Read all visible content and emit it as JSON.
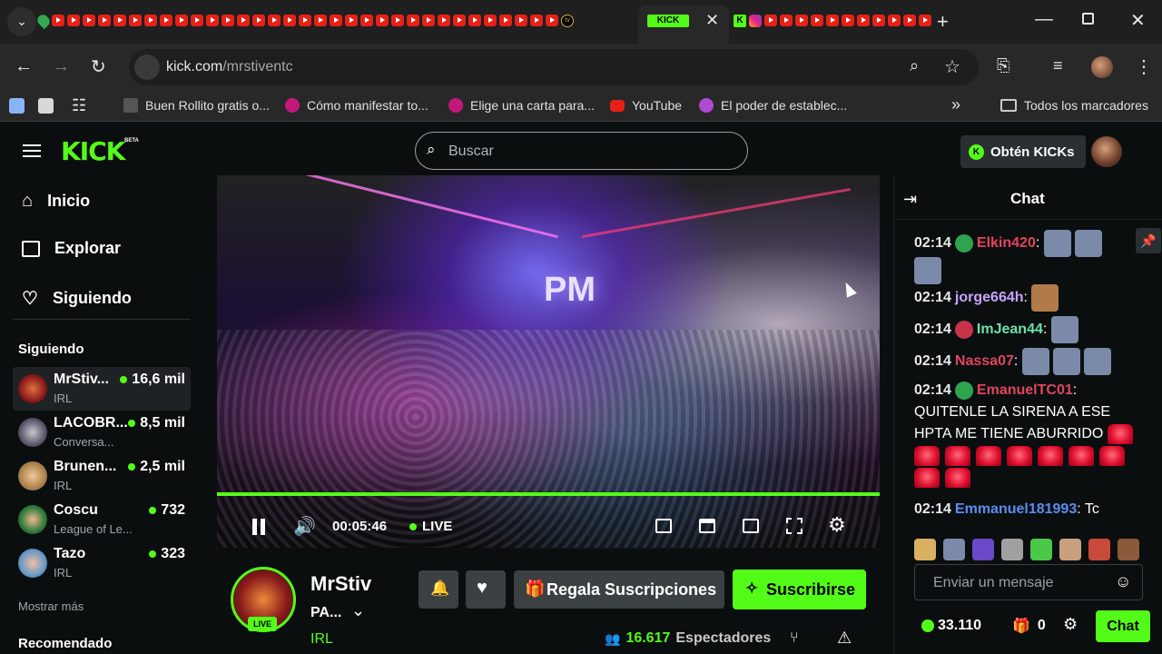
{
  "browser": {
    "active_tab_icon": "KICK",
    "url_domain": "kick.com",
    "url_path": "/mrstiventc",
    "bookmarks": [
      {
        "label": "Buen Rollito gratis o...",
        "color": "#444"
      },
      {
        "label": "Cómo manifestar to...",
        "color": "#c2187b"
      },
      {
        "label": "Elige una carta para...",
        "color": "#c2187b"
      },
      {
        "label": "YouTube",
        "color": "#e62117"
      },
      {
        "label": "El poder de establec...",
        "color": "#b04ad0"
      }
    ],
    "all_bookmarks": "Todos los marcadores"
  },
  "kick": {
    "logo": "KICK",
    "logo_badge": "BETA",
    "search_placeholder": "Buscar",
    "get_kicks": "Obtén KICKs"
  },
  "sidebar": {
    "nav": [
      {
        "label": "Inicio",
        "icon": "home-icon"
      },
      {
        "label": "Explorar",
        "icon": "explore-icon"
      },
      {
        "label": "Siguiendo",
        "icon": "heart-icon"
      }
    ],
    "following_title": "Siguiendo",
    "following": [
      {
        "name": "MrStiv...",
        "category": "IRL",
        "viewers": "16,6 mil",
        "color": "#8a1c1c"
      },
      {
        "name": "LACOBR...",
        "category": "Conversa...",
        "viewers": "8,5 mil",
        "color": "#5a5a6a"
      },
      {
        "name": "Brunen...",
        "category": "IRL",
        "viewers": "2,5 mil",
        "color": "#b0824a"
      },
      {
        "name": "Coscu",
        "category": "League of Le...",
        "viewers": "732",
        "color": "#2f7a3a"
      },
      {
        "name": "Tazo",
        "category": "IRL",
        "viewers": "323",
        "color": "#6a9ac8"
      }
    ],
    "show_more": "Mostrar más",
    "recommended": "Recomendado"
  },
  "player": {
    "time": "00:05:46",
    "live_label": "LIVE",
    "progress": 1.0
  },
  "channel": {
    "name": "MrStiv",
    "title": "PA...",
    "category": "IRL",
    "live_badge": "LIVE",
    "gift_label": "Regala Suscripciones",
    "subscribe_label": "Suscribirse",
    "viewers_count": "16.617",
    "viewers_label": "Espectadores"
  },
  "chat": {
    "title": "Chat",
    "messages": [
      {
        "time": "02:14",
        "user": "Elkin420",
        "color": "#e0455c",
        "text": ""
      },
      {
        "time": "02:14",
        "user": "jorge664h",
        "color": "#c9a3ff",
        "text": ""
      },
      {
        "time": "02:14",
        "user": "ImJean44",
        "color": "#6fe0a8",
        "text": ""
      },
      {
        "time": "02:14",
        "user": "Nassa07",
        "color": "#e0455c",
        "text": ""
      },
      {
        "time": "02:14",
        "user": "EmanuelTC01",
        "color": "#e0455c",
        "text": "QUITENLE LA SIRENA A ESE HPTA ME TIENE ABURRIDO"
      },
      {
        "time": "02:14",
        "user": "Emmanuel181993",
        "color": "#5b8def",
        "text": "Tc"
      }
    ],
    "input_placeholder": "Enviar un mensaje",
    "points": "33.110",
    "gifts": "0",
    "send_label": "Chat"
  }
}
